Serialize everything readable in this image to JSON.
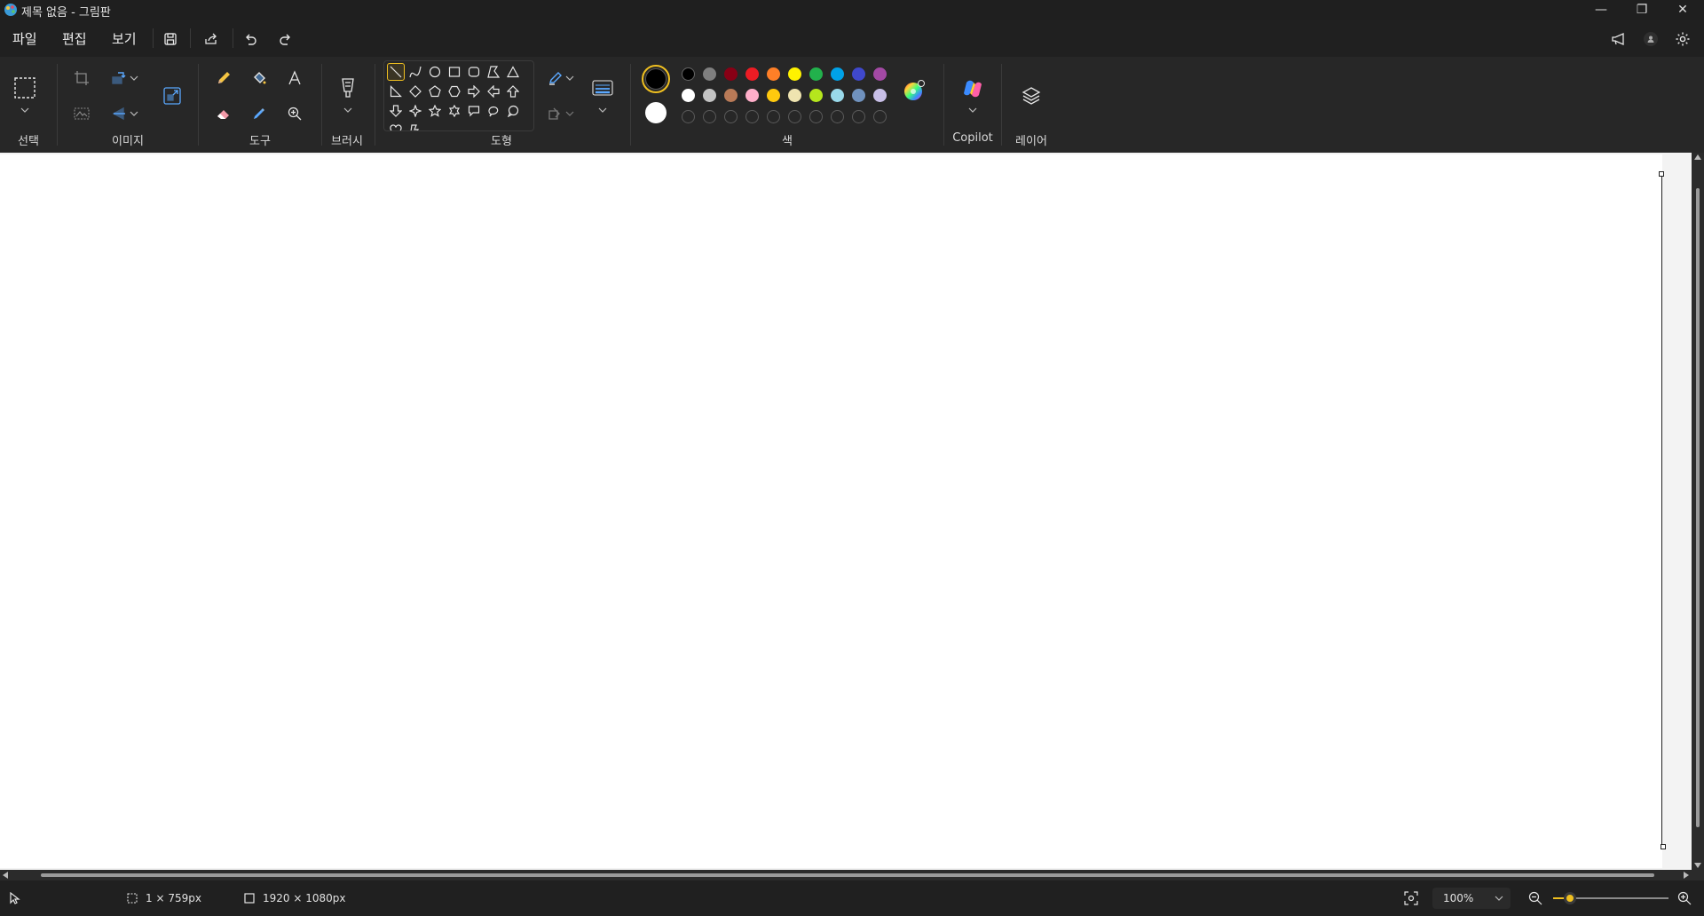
{
  "window": {
    "title": "제목 없음 - 그림판",
    "controls": {
      "minimize": "—",
      "restore": "❐",
      "close": "✕"
    }
  },
  "menu": {
    "file": "파일",
    "edit": "편집",
    "view": "보기"
  },
  "ribbon": {
    "groups": {
      "select": "선택",
      "image": "이미지",
      "tools": "도구",
      "brushes": "브러시",
      "shapes": "도형",
      "colors": "색",
      "copilot": "Copilot",
      "layers": "레이어"
    },
    "palette_row1": [
      "#000000",
      "#7f7f7f",
      "#880015",
      "#ed1c24",
      "#ff7f27",
      "#fff200",
      "#22b14c",
      "#00a2e8",
      "#3f48cc",
      "#a349a4"
    ],
    "palette_row2": [
      "#ffffff",
      "#c3c3c3",
      "#b97a57",
      "#ffaec9",
      "#ffc90e",
      "#efe4b0",
      "#b5e61d",
      "#99d9ea",
      "#7092be",
      "#c8bfe7"
    ],
    "primary_color": "#000000",
    "secondary_color": "#ffffff",
    "accent_color": "#f0c020"
  },
  "status": {
    "selection_size": "1 × 759px",
    "canvas_size": "1920 × 1080px",
    "zoom": "100%",
    "zoom_level": 0.1
  }
}
